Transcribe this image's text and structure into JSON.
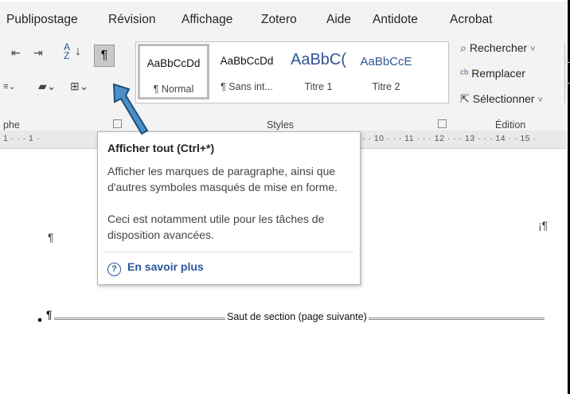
{
  "tabs": [
    "Publipostage",
    "Révision",
    "Affichage",
    "Zotero",
    "Aide",
    "Antidote",
    "Acrobat"
  ],
  "ribbon": {
    "sort_label": "A↓Z",
    "pilcrow": "¶",
    "styles": [
      {
        "preview": "AaBbCcDd",
        "name": "¶ Normal",
        "selected": true
      },
      {
        "preview": "AaBbCcDd",
        "name": "¶ Sans int...",
        "selected": false
      },
      {
        "preview": "AaBbC(",
        "name": "Titre 1",
        "selected": false
      },
      {
        "preview": "AaBbCcE",
        "name": "Titre 2",
        "selected": false
      }
    ],
    "edit": {
      "find": "Rechercher",
      "replace": "Remplacer",
      "select": "Sélectionner"
    },
    "groups": {
      "paragraph": "phe",
      "styles": "Styles",
      "edit": "Édition"
    }
  },
  "ruler": {
    "left": "1 · · · 1 ·",
    "right": "· · 10 · · · 11 · · · 12 · · · 13 · · · 14 ·  · 15 ·"
  },
  "document": {
    "para_mark": "¶",
    "right_mark": "¡¶",
    "section_break": "Saut de section (page suivante)"
  },
  "tooltip": {
    "title": "Afficher tout (Ctrl+*)",
    "desc1": "Afficher les marques de paragraphe, ainsi que d'autres symboles masqués de mise en forme.",
    "desc2": "Ceci est notamment utile pour les tâches de disposition avancées.",
    "more": "En savoir plus",
    "help_icon": "?"
  },
  "colors": {
    "accent": "#2b579a",
    "arrow": "#4a90c8"
  }
}
